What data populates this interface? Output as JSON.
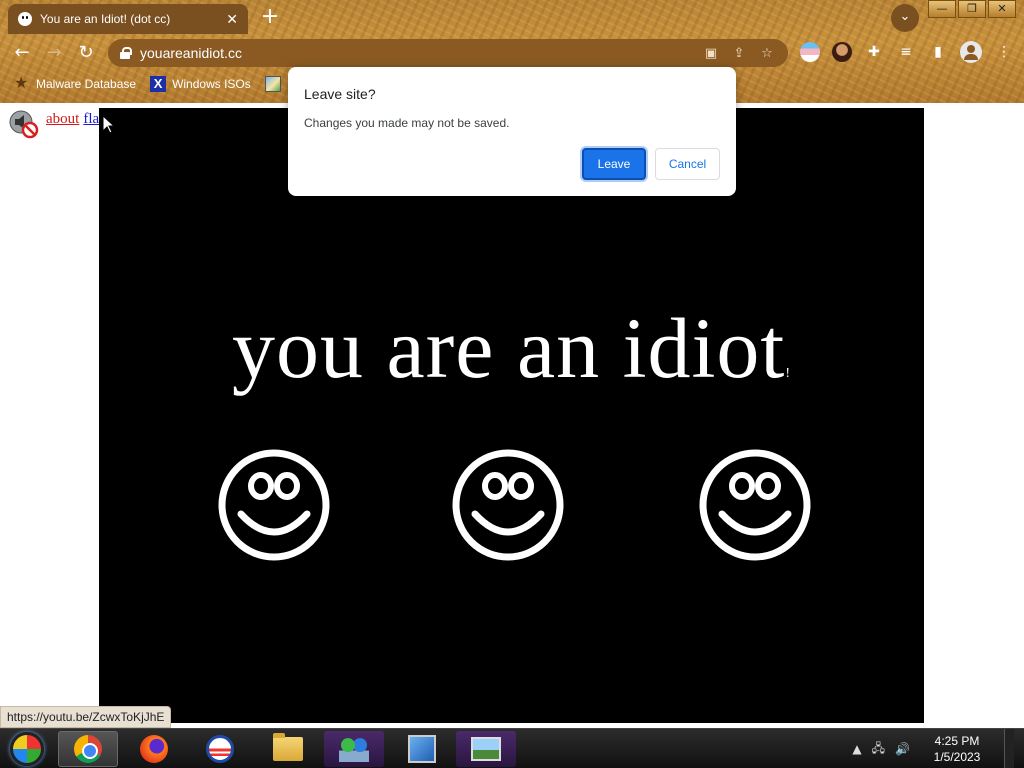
{
  "browser": {
    "tab": {
      "title": "You are an Idiot! (dot cc)",
      "close_glyph": "✕"
    },
    "new_tab_glyph": "+",
    "window_controls": [
      "—",
      "❐",
      "✕"
    ],
    "nav": {
      "back_glyph": "←",
      "forward_glyph": "→",
      "reload_glyph": "↻"
    },
    "url": "youareanidiot.cc",
    "bookmarks": [
      {
        "label": "Malware Database",
        "icon": "star-icon"
      },
      {
        "label": "Windows ISOs",
        "icon": "x-icon"
      },
      {
        "label": "",
        "icon": "image-icon"
      }
    ]
  },
  "page": {
    "links": {
      "about": "about",
      "flash": "flash"
    },
    "headline": "you are an idiot",
    "headline_tail": "!",
    "smiley_count": 3
  },
  "dialog": {
    "title": "Leave site?",
    "message": "Changes you made may not be saved.",
    "leave_label": "Leave",
    "cancel_label": "Cancel"
  },
  "status_bar": {
    "url": "https://youtu.be/ZcwxToKjJhE"
  },
  "taskbar": {
    "time": "4:25 PM",
    "date": "1/5/2023"
  },
  "colors": {
    "accent_blue": "#1a73e8",
    "about_link": "#d01c1c",
    "flash_link": "#1a1ad0",
    "stage_bg": "#000000"
  }
}
